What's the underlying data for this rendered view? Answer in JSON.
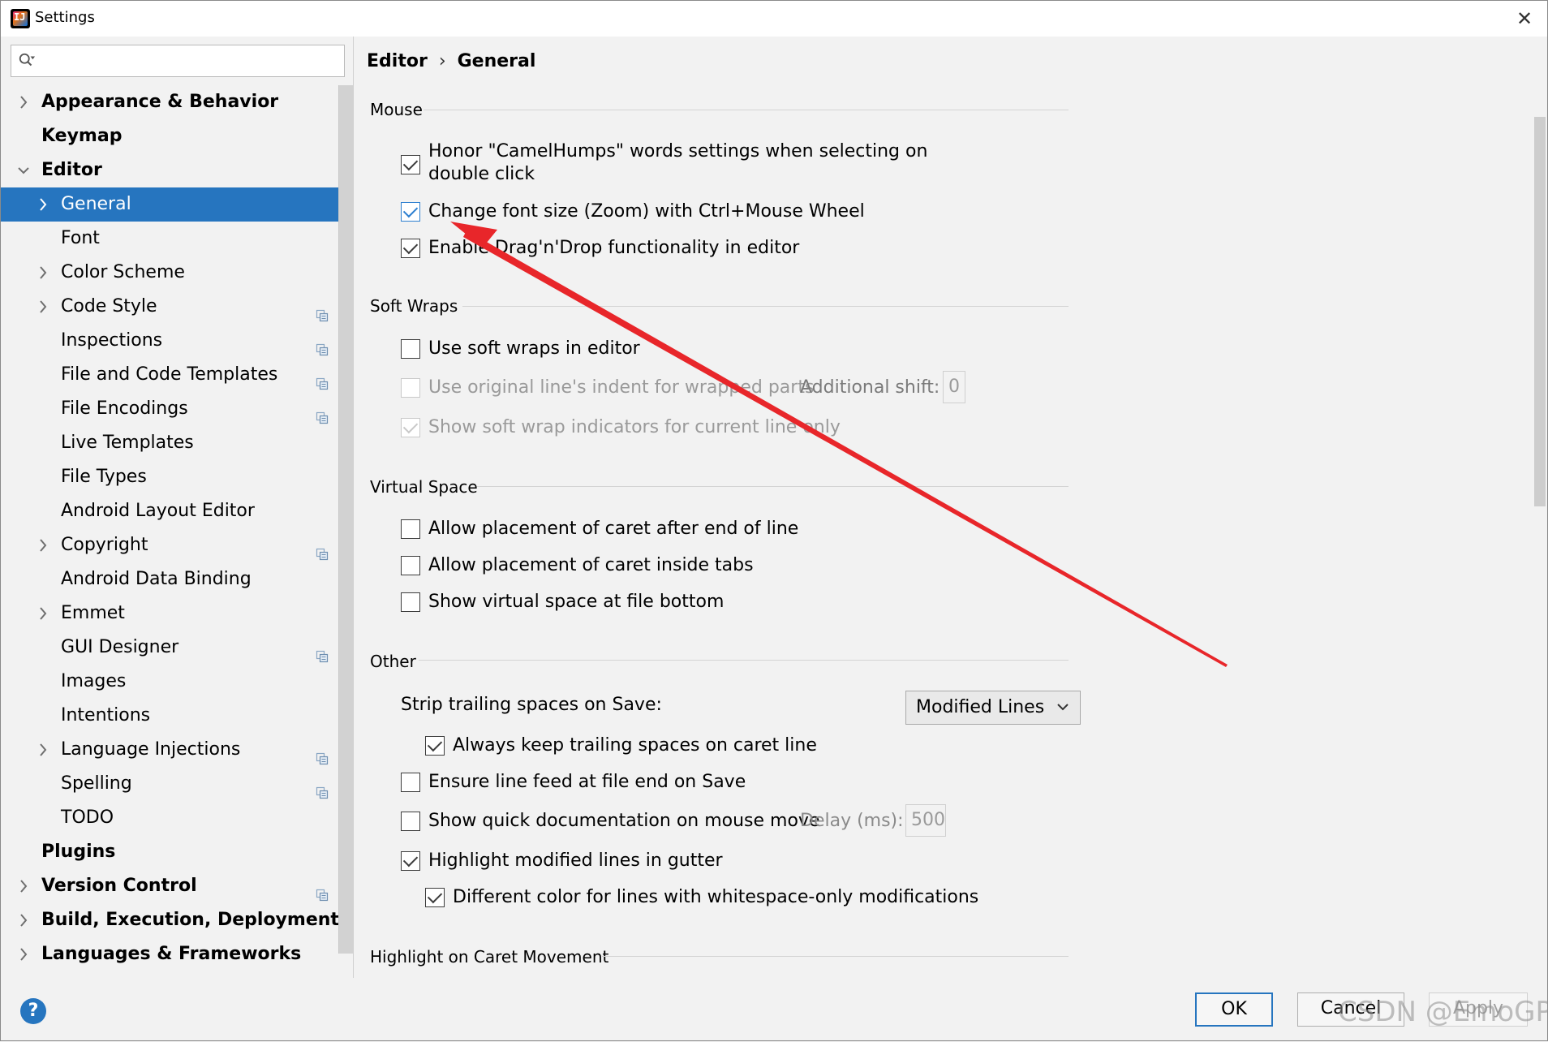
{
  "window": {
    "title": "Settings"
  },
  "search": {
    "placeholder": ""
  },
  "tree": [
    {
      "label": "Appearance & Behavior",
      "level": 0,
      "chevron": "right",
      "bold": true,
      "copy": false
    },
    {
      "label": "Keymap",
      "level": 0,
      "chevron": "",
      "bold": true,
      "copy": false
    },
    {
      "label": "Editor",
      "level": 0,
      "chevron": "down",
      "bold": true,
      "copy": false
    },
    {
      "label": "General",
      "level": 1,
      "chevron": "right",
      "bold": false,
      "copy": false,
      "selected": true
    },
    {
      "label": "Font",
      "level": 1,
      "chevron": "",
      "bold": false,
      "copy": false
    },
    {
      "label": "Color Scheme",
      "level": 1,
      "chevron": "right",
      "bold": false,
      "copy": false
    },
    {
      "label": "Code Style",
      "level": 1,
      "chevron": "right",
      "bold": false,
      "copy": true
    },
    {
      "label": "Inspections",
      "level": 1,
      "chevron": "",
      "bold": false,
      "copy": true
    },
    {
      "label": "File and Code Templates",
      "level": 1,
      "chevron": "",
      "bold": false,
      "copy": true
    },
    {
      "label": "File Encodings",
      "level": 1,
      "chevron": "",
      "bold": false,
      "copy": true
    },
    {
      "label": "Live Templates",
      "level": 1,
      "chevron": "",
      "bold": false,
      "copy": false
    },
    {
      "label": "File Types",
      "level": 1,
      "chevron": "",
      "bold": false,
      "copy": false
    },
    {
      "label": "Android Layout Editor",
      "level": 1,
      "chevron": "",
      "bold": false,
      "copy": false
    },
    {
      "label": "Copyright",
      "level": 1,
      "chevron": "right",
      "bold": false,
      "copy": true
    },
    {
      "label": "Android Data Binding",
      "level": 1,
      "chevron": "",
      "bold": false,
      "copy": false
    },
    {
      "label": "Emmet",
      "level": 1,
      "chevron": "right",
      "bold": false,
      "copy": false
    },
    {
      "label": "GUI Designer",
      "level": 1,
      "chevron": "",
      "bold": false,
      "copy": true
    },
    {
      "label": "Images",
      "level": 1,
      "chevron": "",
      "bold": false,
      "copy": false
    },
    {
      "label": "Intentions",
      "level": 1,
      "chevron": "",
      "bold": false,
      "copy": false
    },
    {
      "label": "Language Injections",
      "level": 1,
      "chevron": "right",
      "bold": false,
      "copy": true
    },
    {
      "label": "Spelling",
      "level": 1,
      "chevron": "",
      "bold": false,
      "copy": true
    },
    {
      "label": "TODO",
      "level": 1,
      "chevron": "",
      "bold": false,
      "copy": false
    },
    {
      "label": "Plugins",
      "level": 0,
      "chevron": "",
      "bold": true,
      "copy": false
    },
    {
      "label": "Version Control",
      "level": 0,
      "chevron": "right",
      "bold": true,
      "copy": true
    },
    {
      "label": "Build, Execution, Deployment",
      "level": 0,
      "chevron": "right",
      "bold": true,
      "copy": false
    },
    {
      "label": "Languages & Frameworks",
      "level": 0,
      "chevron": "right",
      "bold": true,
      "copy": false
    }
  ],
  "breadcrumb": {
    "parent": "Editor",
    "current": "General",
    "separator": "›"
  },
  "sections": {
    "mouse": "Mouse",
    "soft_wraps": "Soft Wraps",
    "virtual_space": "Virtual Space",
    "other": "Other",
    "highlight_caret": "Highlight on Caret Movement"
  },
  "options": {
    "camel_humps_1": "Honor \"CamelHumps\" words settings when selecting on",
    "camel_humps_2": "double click",
    "zoom": "Change font size (Zoom) with Ctrl+Mouse Wheel",
    "drag_drop": "Enable Drag'n'Drop functionality in editor",
    "soft_wraps": "Use soft wraps in editor",
    "original_indent": "Use original line's indent for wrapped parts",
    "additional_shift_label": "Additional shift:",
    "additional_shift_value": "0",
    "soft_wrap_indicators": "Show soft wrap indicators for current line only",
    "caret_after_end": "Allow placement of caret after end of line",
    "caret_inside_tabs": "Allow placement of caret inside tabs",
    "virtual_space_bottom": "Show virtual space at file bottom",
    "strip_trailing_label": "Strip trailing spaces on Save:",
    "strip_trailing_value": "Modified Lines",
    "keep_trailing": "Always keep trailing spaces on caret line",
    "line_feed": "Ensure line feed at file end on Save",
    "quick_doc": "Show quick documentation on mouse move",
    "delay_label": "Delay (ms):",
    "delay_value": "500",
    "highlight_modified": "Highlight modified lines in gutter",
    "whitespace_color": "Different color for lines with whitespace-only modifications"
  },
  "buttons": {
    "ok": "OK",
    "cancel": "Cancel",
    "apply": "Apply",
    "help": "?"
  },
  "watermark": "CSDN @EmoGP",
  "colors": {
    "selection": "#2675bf",
    "annotation_arrow": "#e8262a"
  }
}
